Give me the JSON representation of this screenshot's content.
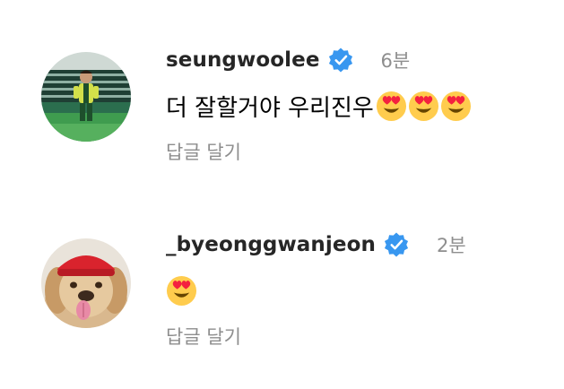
{
  "comments": [
    {
      "username": "seungwoolee",
      "time": "6분",
      "text": "더 잘할거야 우리진우",
      "emoji": [
        "heart-eyes",
        "heart-eyes",
        "heart-eyes"
      ],
      "reply_label": "답글 달기"
    },
    {
      "username": "_byeonggwanjeon",
      "time": "2분",
      "text": "",
      "emoji": [
        "heart-eyes"
      ],
      "reply_label": "답글 달기"
    }
  ],
  "colors": {
    "verified": "#3897f0",
    "muted": "#8e8e8e",
    "text": "#262626"
  }
}
